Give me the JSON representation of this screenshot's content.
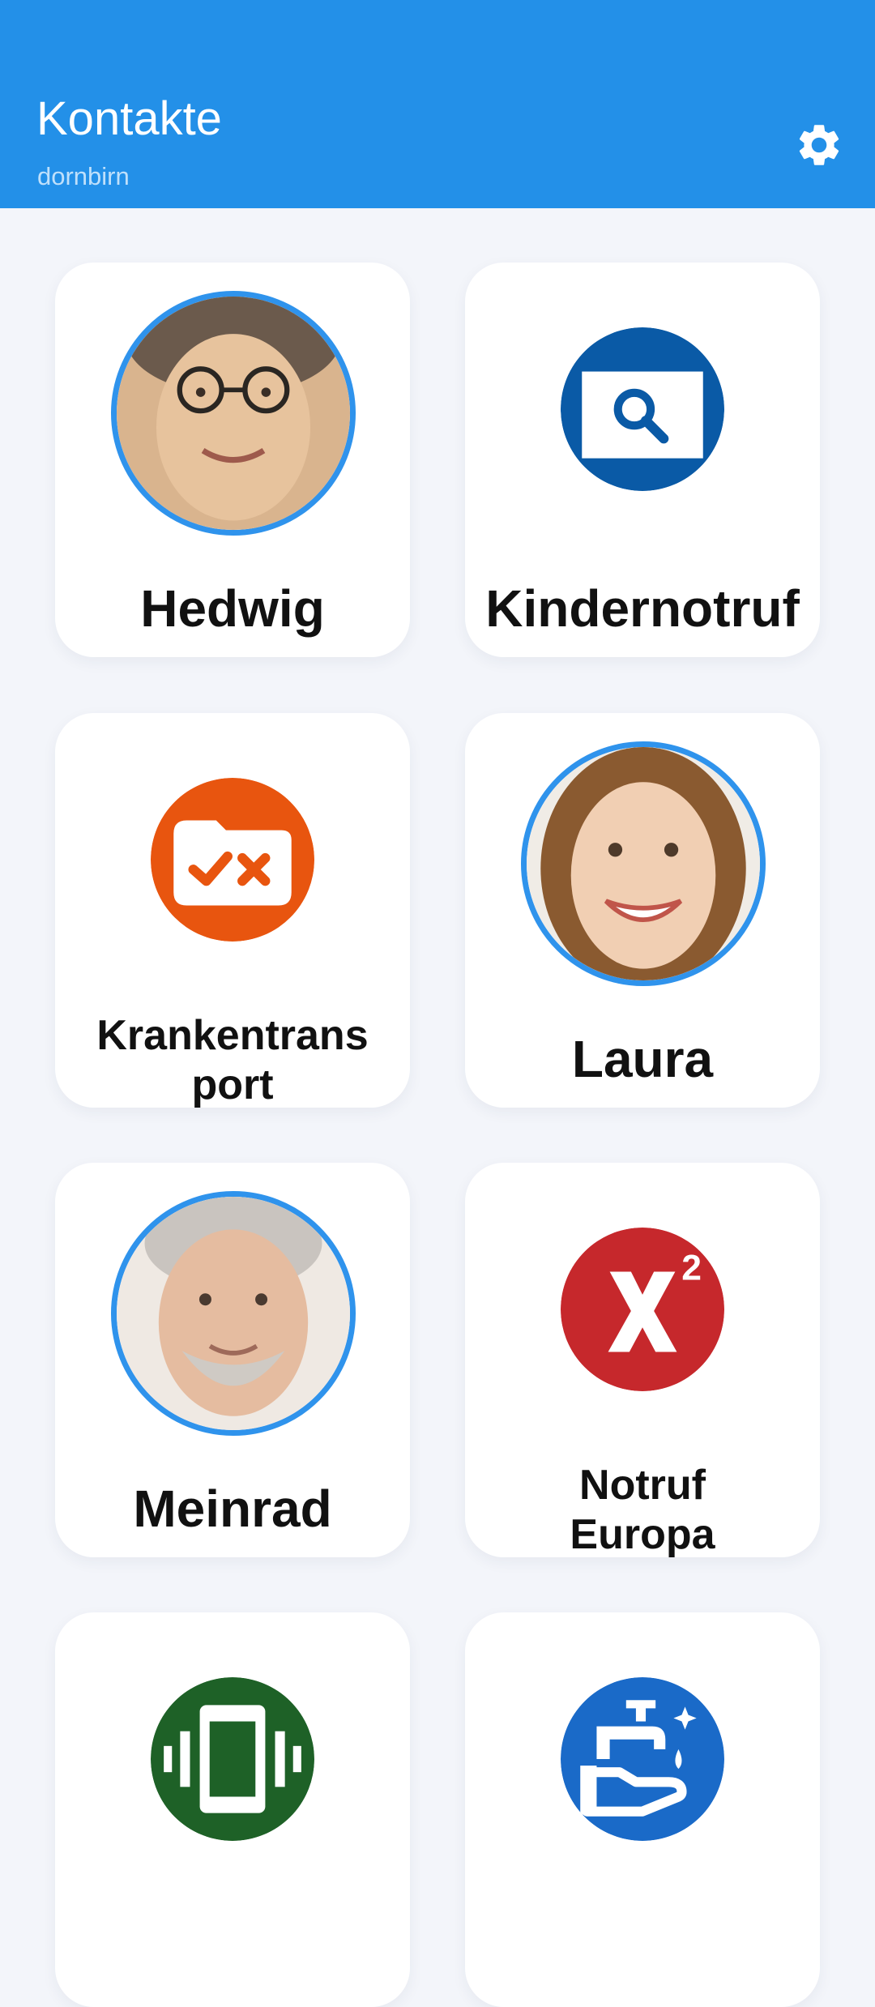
{
  "header": {
    "title": "Kontakte",
    "subtitle": "dornbirn",
    "settings_icon": "gear-icon"
  },
  "colors": {
    "appbar": "#2390e8",
    "avatar_ring": "#2f93ec",
    "background": "#f3f5fa"
  },
  "contacts": [
    {
      "name": "Hedwig",
      "type": "photo"
    },
    {
      "name": "Kindernotruf",
      "type": "icon",
      "icon": "search-window-icon",
      "color": "#0a5aa6"
    },
    {
      "name": "Krankentrans\nport",
      "type": "icon",
      "icon": "folder-check-x-icon",
      "color": "#e8550f"
    },
    {
      "name": "Laura",
      "type": "photo"
    },
    {
      "name": "Meinrad",
      "type": "photo"
    },
    {
      "name": "Notruf\nEuropa",
      "type": "icon",
      "icon": "superscript-x2-icon",
      "color": "#c6282c"
    },
    {
      "name": "",
      "type": "icon",
      "icon": "vibrate-phone-icon",
      "color": "#1e6127"
    },
    {
      "name": "",
      "type": "icon",
      "icon": "hand-wash-icon",
      "color": "#1a6ac8"
    }
  ]
}
